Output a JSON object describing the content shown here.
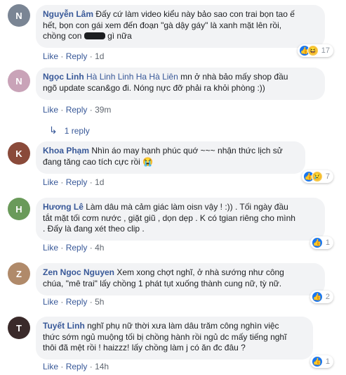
{
  "comments": [
    {
      "author": "Nguyễn Lâm",
      "text_lines": [
        "Đấy cứ làm video kiểu này bảo sao con trai bọn tao ế",
        "hết, bọn con gái xem đến đoạn \"gà dậy gáy\" là xanh mặt lên rồi,",
        "chồng con",
        "gì nữa"
      ],
      "like": "Like",
      "reply": "Reply",
      "time": "1d",
      "reaction_count": "17",
      "avatar_color": "#7a8594"
    },
    {
      "author": "Ngọc Linh",
      "tags": "Hà Linh Linh Ha Hà Liên",
      "text_lines": [
        "mn ở nhà bảo mấy shop đầu",
        "ngõ update scan&go đi. Nóng nực đỡ phải ra khỏi phòng :))"
      ],
      "like": "Like",
      "reply": "Reply",
      "time": "39m",
      "replies_label": "1 reply",
      "avatar_color": "#c9a3b8"
    },
    {
      "author": "Khoa Phạm",
      "text_lines": [
        "Nhìn áo may hạnh phúc quớ ~~~ nhận thức lịch sử",
        "đang tăng cao tích cực rồi 😭"
      ],
      "like": "Like",
      "reply": "Reply",
      "time": "1d",
      "reaction_count": "7",
      "avatar_color": "#8a4a3a"
    },
    {
      "author": "Hương Lê",
      "text_lines": [
        "Làm dâu mà cảm giác làm oisn vậy ! :)) . Tối ngày đầu",
        "tắt mặt tối cơm nước , giặt giũ , dọn dẹp . K có tgian riêng cho mình",
        ". Đấy là đang xét theo clip ."
      ],
      "like": "Like",
      "reply": "Reply",
      "time": "4h",
      "reaction_count": "1",
      "avatar_color": "#6a9a5a"
    },
    {
      "author": "Zen Ngoc Nguyen",
      "text_lines": [
        "Xem xong chợt nghĩ, ở nhà sướng như công",
        "chúa, \"mê trai\" lấy chồng 1 phát tụt xuống thành cung nữ, tỳ nữ."
      ],
      "like": "Like",
      "reply": "Reply",
      "time": "5h",
      "reaction_count": "2",
      "avatar_color": "#b08a6a"
    },
    {
      "author": "Tuyết Linh",
      "text_lines": [
        "nghĩ phụ nữ thời xưa làm dâu trăm công nghìn việc",
        "thức sớm ngủ muộng tối bị chồng hành rồi ngủ dc mấy tiếng nghĩ",
        "thôi đã mệt rồi ! haizzz! lấy chồng làm j có ăn đc đâu ?"
      ],
      "like": "Like",
      "reply": "Reply",
      "time": "14h",
      "reaction_count": "1",
      "avatar_color": "#3a2a2a"
    }
  ],
  "separator": "·",
  "colors": {
    "link": "#385898",
    "bubble": "#f2f3f5",
    "like_blue": "#1877f2"
  }
}
